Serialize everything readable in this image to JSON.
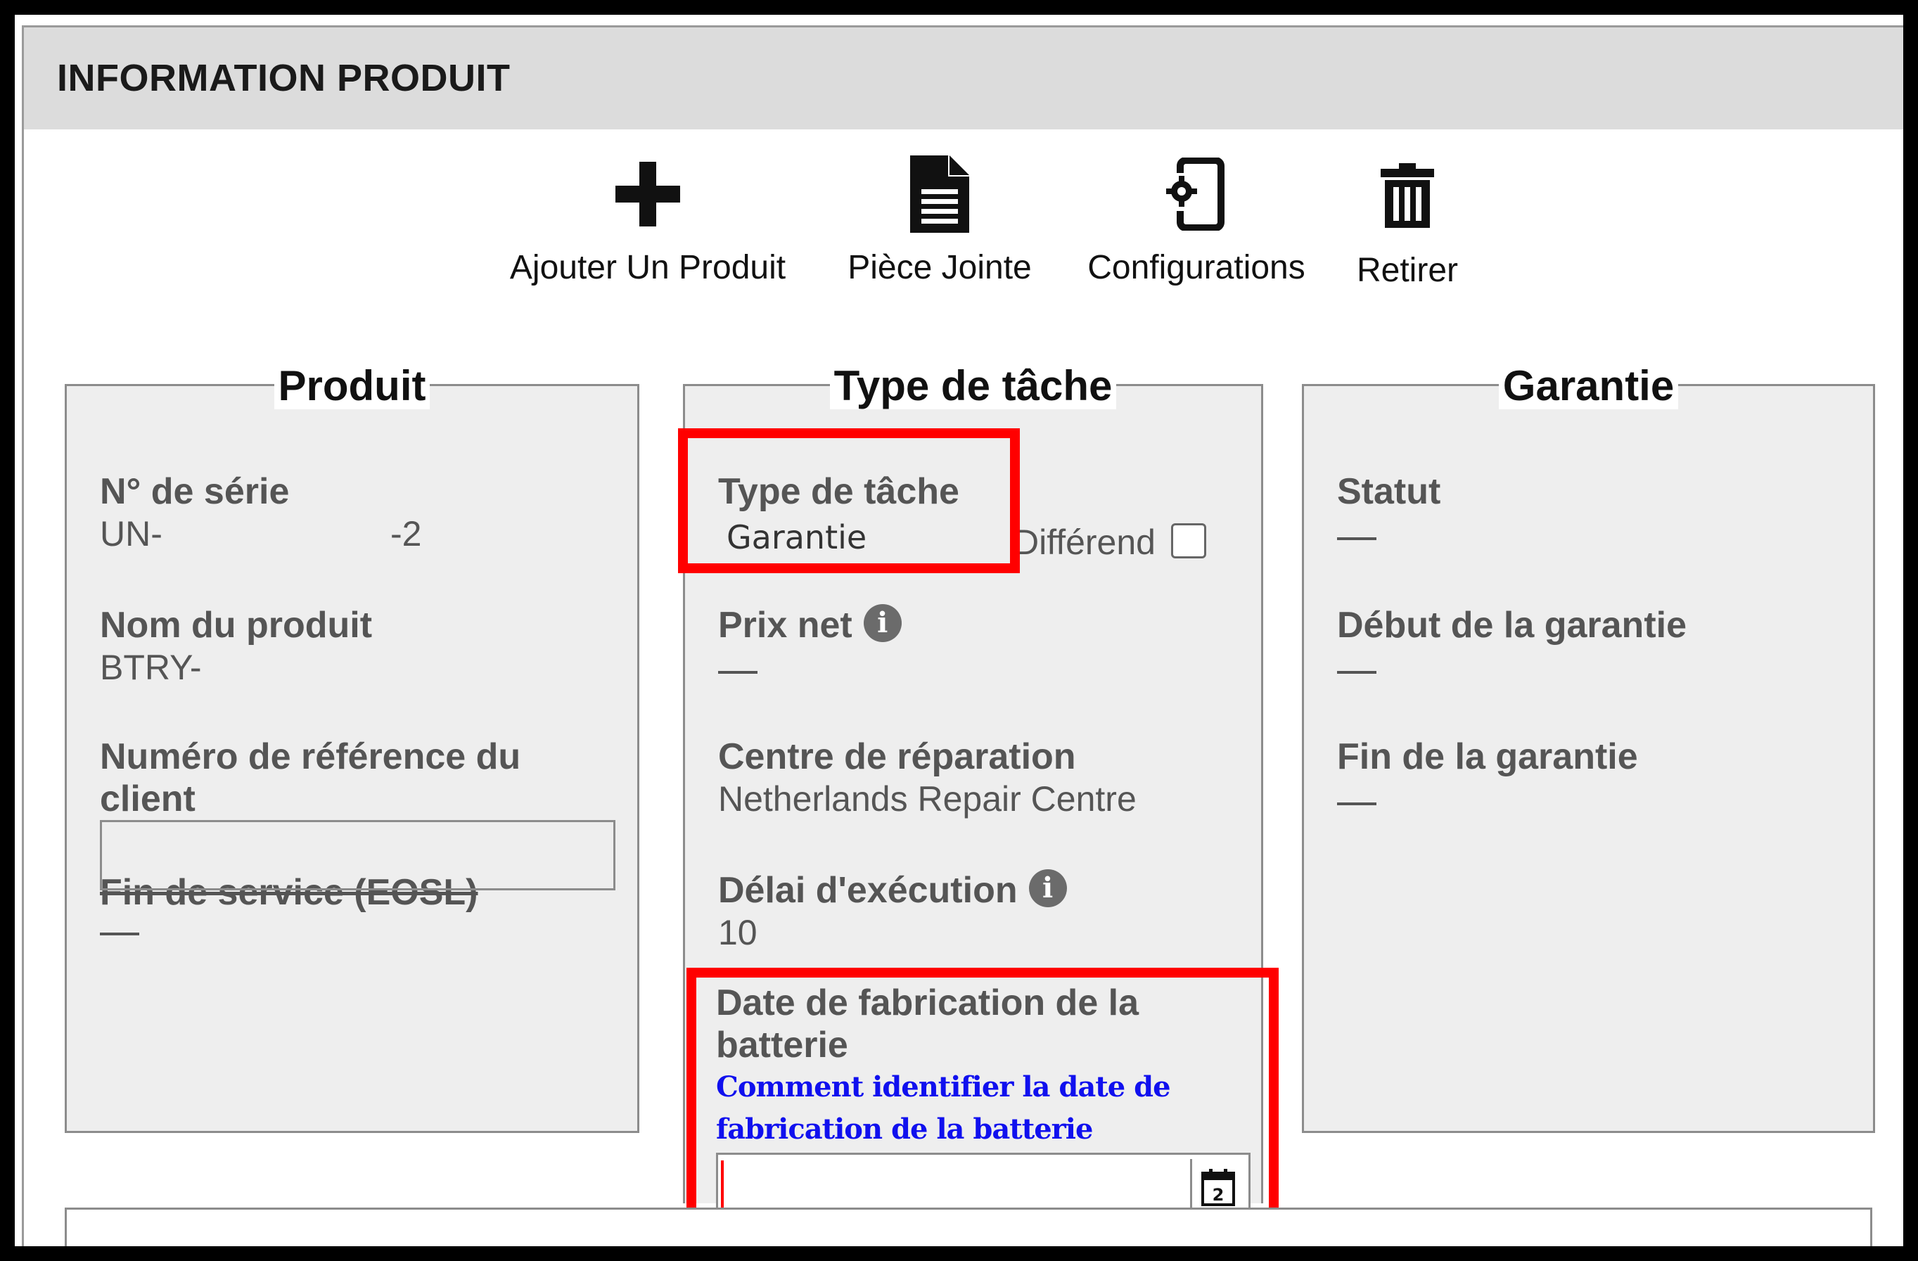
{
  "header": {
    "title": "INFORMATION PRODUIT"
  },
  "toolbar": {
    "add_product": {
      "label": "Ajouter Un Produit",
      "icon": "plus-icon"
    },
    "attachment": {
      "label": "Pièce Jointe",
      "icon": "document-icon"
    },
    "configurations": {
      "label": "Configurations",
      "icon": "device-gear-icon"
    },
    "remove": {
      "label": "Retirer",
      "icon": "trash-icon"
    }
  },
  "produit": {
    "legend": "Produit",
    "serial_label": "N° de série",
    "serial_prefix": "UN-",
    "serial_suffix": "-2",
    "name_label": "Nom du produit",
    "name_value": "BTRY-",
    "ref_label": "Numéro de référence du client",
    "ref_value": "",
    "eosl_label": "Fin de service (EOSL)",
    "eosl_value": "—"
  },
  "task": {
    "legend": "Type de tâche",
    "type_label": "Type de tâche",
    "type_value": "Garantie",
    "dispute_label": "Différend",
    "dispute_checked": false,
    "price_label": "Prix net",
    "price_value": "—",
    "repair_label": "Centre de réparation",
    "repair_value": "Netherlands Repair Centre",
    "lead_label": "Délai d'exécution",
    "lead_value": "10",
    "battery_label": "Date de fabrication de la batterie",
    "battery_link": "Comment identifier la date de fabrication de la batterie",
    "battery_date": ""
  },
  "garantie": {
    "legend": "Garantie",
    "status_label": "Statut",
    "status_value": "—",
    "start_label": "Début de la garantie",
    "start_value": "—",
    "end_label": "Fin de la garantie",
    "end_value": "—"
  },
  "colors": {
    "highlight": "#ff0000",
    "link": "#1010ee",
    "header_bg": "#dcdcdc",
    "panel_bg": "#eeeeee"
  }
}
